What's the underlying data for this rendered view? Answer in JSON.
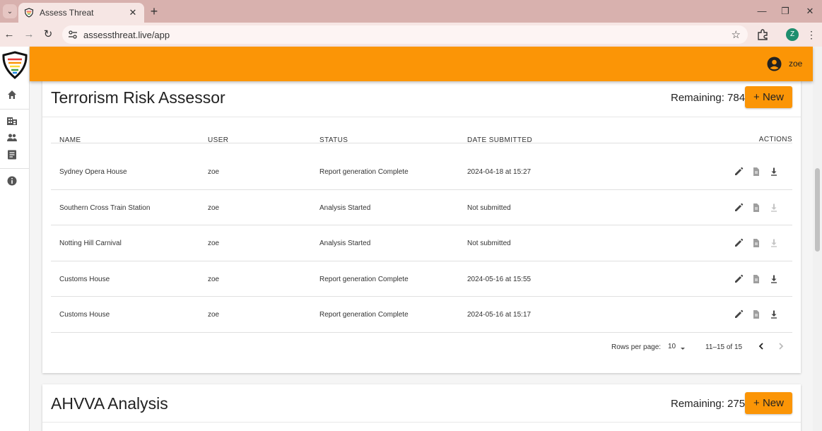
{
  "browser": {
    "tab_title": "Assess Threat",
    "tab_close": "✕",
    "new_tab": "+",
    "url": "assessthreat.live/app",
    "profile_initial": "Z",
    "controls": {
      "minimize": "—",
      "maximize": "❐",
      "close": "✕"
    }
  },
  "appbar": {
    "user_name": "zoe"
  },
  "sidebar": {
    "items": [
      {
        "icon": "home-icon"
      },
      {
        "icon": "building-icon"
      },
      {
        "icon": "people-icon"
      },
      {
        "icon": "document-icon"
      },
      {
        "icon": "info-icon"
      }
    ]
  },
  "terrorism": {
    "title": "Terrorism Risk Assessor",
    "remaining": "Remaining: 784",
    "new_label": "+ New",
    "columns": {
      "name": "NAME",
      "user": "USER",
      "status": "STATUS",
      "date": "DATE SUBMITTED",
      "actions": "ACTIONS"
    },
    "rows": [
      {
        "name": "Sydney Opera House",
        "user": "zoe",
        "status": "Report generation Complete",
        "date": "2024-04-18 at 15:27",
        "download_enabled": true
      },
      {
        "name": "Southern Cross Train Station",
        "user": "zoe",
        "status": "Analysis Started",
        "date": "Not submitted",
        "download_enabled": false
      },
      {
        "name": "Notting Hill Carnival",
        "user": "zoe",
        "status": "Analysis Started",
        "date": "Not submitted",
        "download_enabled": false
      },
      {
        "name": "Customs House",
        "user": "zoe",
        "status": "Report generation Complete",
        "date": "2024-05-16 at 15:55",
        "download_enabled": true
      },
      {
        "name": "Customs House",
        "user": "zoe",
        "status": "Report generation Complete",
        "date": "2024-05-16 at 15:17",
        "download_enabled": true
      }
    ],
    "pagination": {
      "rows_per_page_label": "Rows per page:",
      "rows_per_page": "10",
      "range": "11–15 of 15"
    }
  },
  "ahvva": {
    "title": "AHVVA Analysis",
    "remaining": "Remaining: 275",
    "new_label": "+ New"
  },
  "colors": {
    "brand_orange": "#fb9506",
    "chrome_tab": "#d8b1ae",
    "chrome_bar": "#f6e6e4"
  }
}
